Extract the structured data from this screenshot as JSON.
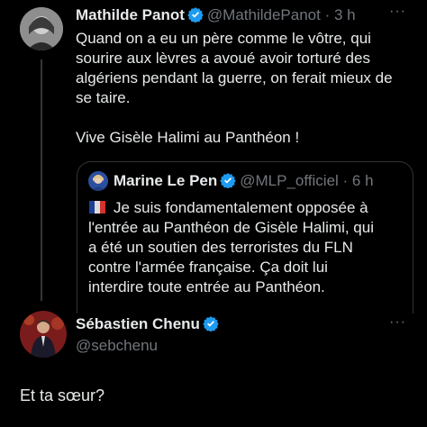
{
  "tweet1": {
    "display_name": "Mathilde Panot",
    "handle_time": "@MathildePanot · 3 h",
    "text_lines": [
      "Quand on a eu un père comme le vôtre, qui",
      "sourire aux lèvres a avoué avoir torturé des",
      "algériens pendant la guerre, on ferait mieux de",
      "se taire.",
      "",
      "Vive Gisèle Halimi au Panthéon !"
    ],
    "more": "···"
  },
  "quote": {
    "display_name": "Marine Le Pen",
    "handle_time": "@MLP_officiel · 6 h",
    "flag_icon": "🇫🇷",
    "text_lines": [
      "Je suis fondamentalement opposée à",
      "l'entrée au Panthéon de Gisèle Halimi, qui",
      "a été un soutien des terroristes du FLN",
      "contre l'armée française. Ça doit lui",
      "interdire toute entrée au Panthéon."
    ]
  },
  "tweet2": {
    "display_name": "Sébastien Chenu",
    "handle": "@sebchenu",
    "text": "Et ta sœur?",
    "more": "···"
  },
  "colors": {
    "background": "#000000",
    "text": "#e7e9ea",
    "secondary": "#71767b",
    "verified": "#1d9bf0",
    "border": "#2f3336"
  }
}
